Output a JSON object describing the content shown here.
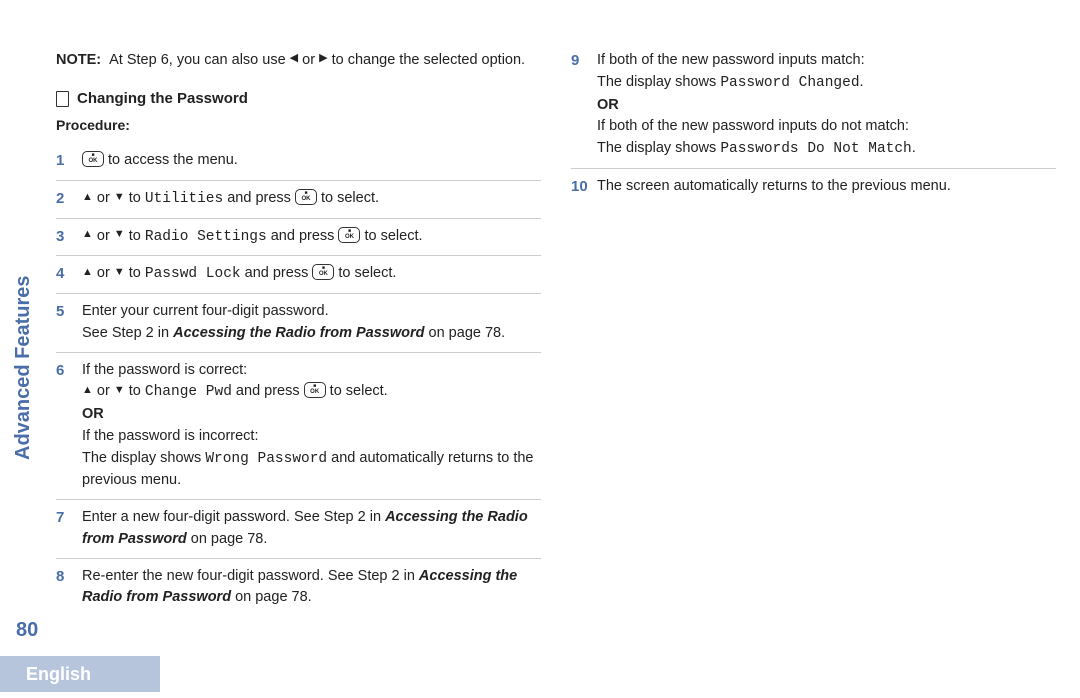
{
  "sidebar": {
    "section": "Advanced Features"
  },
  "pageNumber": "80",
  "language": "English",
  "note": {
    "label": "NOTE:",
    "text_a": "At Step 6, you can also use ",
    "text_b": " or ",
    "text_c": " to change the selected option."
  },
  "section": {
    "title": "Changing the Password",
    "procedure_label": "Procedure:"
  },
  "words": {
    "or": " or ",
    "to": " to ",
    "and_press": " and press ",
    "to_select": " to select.",
    "to_access": " to access the menu.",
    "OR": "OR"
  },
  "menu": {
    "utilities": "Utilities",
    "radio_settings": "Radio Settings",
    "passwd_lock": "Passwd Lock",
    "change_pwd": "Change Pwd",
    "wrong_password": "Wrong Password",
    "password_changed": "Password Changed",
    "passwords_no_match": "Passwords Do Not Match"
  },
  "steps": {
    "s5a": "Enter your current four-digit password.",
    "s5b_pre": "See Step 2 in ",
    "xref": "Accessing the Radio from Password",
    "s5b_post": " on page 78.",
    "s6a": "If the password is correct:",
    "s6c": "If the password is incorrect:",
    "s6d_pre": "The display shows ",
    "s6d_post": " and automatically returns to the previous menu.",
    "s7a": "Enter a new four-digit password. See Step 2 in ",
    "s7b": " on page 78.",
    "s8a": "Re-enter the new four-digit password.  See Step 2 in ",
    "s8b": " on page 78.",
    "s9a": "If both of the new password inputs match:",
    "s9b_pre": "The display shows ",
    "s9b_post": ".",
    "s9c": "If both of the new password inputs do not match:",
    "s9d_pre": "The display shows ",
    "s9d_post": ".",
    "s10": "The screen automatically returns to the previous menu."
  },
  "nums": {
    "n1": "1",
    "n2": "2",
    "n3": "3",
    "n4": "4",
    "n5": "5",
    "n6": "6",
    "n7": "7",
    "n8": "8",
    "n9": "9",
    "n10": "10"
  }
}
